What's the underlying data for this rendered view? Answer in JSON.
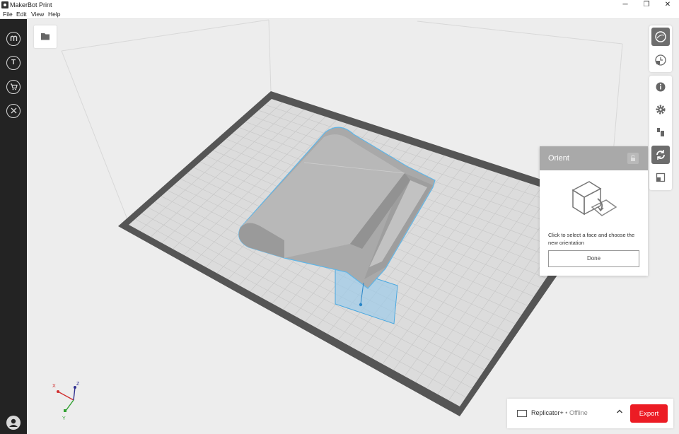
{
  "window": {
    "title": "MakerBot Print",
    "minimize": "─",
    "maximize": "❐",
    "close": "✕"
  },
  "menu": {
    "items": [
      "File",
      "Edit",
      "View",
      "Help"
    ]
  },
  "sidebar": {
    "items": [
      {
        "icon": "makerbot-logo-icon",
        "glyph": "M"
      },
      {
        "icon": "thingiverse-icon",
        "glyph": "T"
      },
      {
        "icon": "store-cart-icon",
        "glyph": ""
      },
      {
        "icon": "tools-icon",
        "glyph": ""
      },
      {
        "icon": "user-avatar-icon",
        "glyph": ""
      }
    ]
  },
  "orient": {
    "title": "Orient",
    "description": "Click to select a face and choose the new orientation",
    "done_label": "Done"
  },
  "printer": {
    "name": "Replicator+",
    "separator": " • ",
    "status": "Offline"
  },
  "export": {
    "label": "Export"
  },
  "axes": {
    "x": "X",
    "y": "Y",
    "z": "Z"
  },
  "colors": {
    "accent_red": "#ec1c24",
    "sidebar": "#232323",
    "selection_blue": "#4aa8e0",
    "active_tool": "#6d6d6d"
  }
}
